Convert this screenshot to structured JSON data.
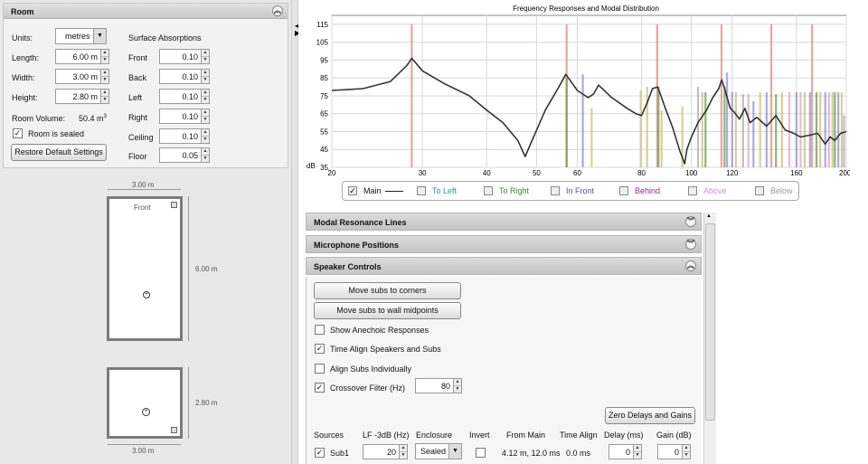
{
  "room": {
    "title": "Room",
    "units_label": "Units:",
    "units_value": "metres",
    "length_label": "Length:",
    "length_value": "6.00 m",
    "width_label": "Width:",
    "width_value": "3.00 m",
    "height_label": "Height:",
    "height_value": "2.80 m",
    "volume_label": "Room Volume:",
    "volume_value": "50.4 m",
    "volume_sup": "3",
    "sealed_label": "Room is sealed",
    "sealed_checked": true,
    "restore_button": "Restore Default Settings",
    "absorptions_title": "Surface Absorptions",
    "absorptions": [
      {
        "label": "Front",
        "value": "0.10"
      },
      {
        "label": "Back",
        "value": "0.10"
      },
      {
        "label": "Left",
        "value": "0.10"
      },
      {
        "label": "Right",
        "value": "0.10"
      },
      {
        "label": "Ceiling",
        "value": "0.10"
      },
      {
        "label": "Floor",
        "value": "0.05"
      }
    ]
  },
  "plan": {
    "top_width": "3.00 m",
    "side_length": "6.00 m",
    "front_label": "Front",
    "side_height": "2.80 m",
    "bottom_width": "3.00 m"
  },
  "chart_data": {
    "type": "line",
    "title": "Frequency Responses and Modal Distribution",
    "yunit": "dB",
    "y_ticks": [
      "35",
      "45",
      "55",
      "65",
      "75",
      "85",
      "95",
      "105",
      "115"
    ],
    "x_ticks": [
      "20",
      "30",
      "40",
      "50",
      "60",
      "80",
      "100",
      "120",
      "160",
      "200 Hz"
    ],
    "x_tick_values": [
      20,
      30,
      40,
      50,
      60,
      80,
      100,
      120,
      160,
      200
    ],
    "xscale": "log",
    "xlim": [
      20,
      200
    ],
    "ylim": [
      35,
      120
    ],
    "grid": true,
    "series": [
      {
        "name": "Main",
        "x": [
          20,
          23,
          26,
          28,
          28.6,
          30,
          33,
          37,
          40,
          43,
          46,
          47.5,
          49,
          52,
          55,
          57,
          58,
          60,
          61.5,
          63,
          64.5,
          66,
          70,
          75,
          78,
          80,
          82,
          84,
          86,
          87,
          89,
          92,
          95,
          97,
          98,
          100,
          103,
          107,
          110,
          113,
          114.5,
          116,
          119,
          121,
          124,
          127,
          130,
          134,
          140,
          146,
          152,
          158,
          163,
          170,
          176,
          182,
          186,
          190,
          195,
          200
        ],
        "y": [
          78,
          79,
          83,
          92,
          96,
          89,
          82,
          75,
          67,
          60,
          50,
          41,
          50,
          67,
          79,
          87,
          84,
          78,
          76,
          74,
          76,
          81,
          74,
          68,
          65,
          64,
          71,
          79,
          80,
          76,
          68,
          57,
          44,
          37,
          45,
          52,
          60,
          67,
          74,
          79,
          84,
          79,
          68,
          66,
          62,
          68,
          60,
          63,
          58,
          64,
          56,
          54,
          52,
          53,
          54,
          48,
          52,
          50,
          54,
          55
        ]
      }
    ],
    "modes": {
      "colors": {
        "red": "#d98a8a",
        "green": "#6e9a4a",
        "blue": "#8d91d2",
        "olive": "#c9c078",
        "pink": "#e2a0cc",
        "gray": "#aaaaaa"
      },
      "lines": [
        {
          "f": 28.6,
          "h": 115,
          "c": "red"
        },
        {
          "f": 57.2,
          "h": 115,
          "c": "red"
        },
        {
          "f": 57.2,
          "h": 85,
          "c": "green"
        },
        {
          "f": 61.5,
          "h": 87,
          "c": "blue"
        },
        {
          "f": 64,
          "h": 68,
          "c": "olive"
        },
        {
          "f": 79.7,
          "h": 78,
          "c": "olive"
        },
        {
          "f": 82,
          "h": 80,
          "c": "olive"
        },
        {
          "f": 85.8,
          "h": 115,
          "c": "red"
        },
        {
          "f": 86.3,
          "h": 80,
          "c": "green"
        },
        {
          "f": 87.5,
          "h": 67,
          "c": "olive"
        },
        {
          "f": 96,
          "h": 69,
          "c": "olive"
        },
        {
          "f": 103,
          "h": 80,
          "c": "gray"
        },
        {
          "f": 105,
          "h": 77,
          "c": "olive"
        },
        {
          "f": 106.5,
          "h": 77,
          "c": "green"
        },
        {
          "f": 114.4,
          "h": 115,
          "c": "red"
        },
        {
          "f": 116,
          "h": 80,
          "c": "green"
        },
        {
          "f": 117.3,
          "h": 88,
          "c": "blue"
        },
        {
          "f": 120,
          "h": 77,
          "c": "blue"
        },
        {
          "f": 122,
          "h": 77,
          "c": "olive"
        },
        {
          "f": 126,
          "h": 76,
          "c": "gray"
        },
        {
          "f": 129,
          "h": 76,
          "c": "pink"
        },
        {
          "f": 132,
          "h": 72,
          "c": "blue"
        },
        {
          "f": 136,
          "h": 77,
          "c": "olive"
        },
        {
          "f": 140,
          "h": 77,
          "c": "blue"
        },
        {
          "f": 143,
          "h": 115,
          "c": "red"
        },
        {
          "f": 146,
          "h": 76,
          "c": "green"
        },
        {
          "f": 150,
          "h": 77,
          "c": "olive"
        },
        {
          "f": 155,
          "h": 77,
          "c": "pink"
        },
        {
          "f": 160,
          "h": 77,
          "c": "blue"
        },
        {
          "f": 163,
          "h": 77,
          "c": "pink"
        },
        {
          "f": 166,
          "h": 77,
          "c": "olive"
        },
        {
          "f": 170,
          "h": 77,
          "c": "blue"
        },
        {
          "f": 171.6,
          "h": 115,
          "c": "red"
        },
        {
          "f": 175,
          "h": 77,
          "c": "green"
        },
        {
          "f": 178,
          "h": 77,
          "c": "olive"
        },
        {
          "f": 182,
          "h": 77,
          "c": "blue"
        },
        {
          "f": 185,
          "h": 77,
          "c": "pink"
        },
        {
          "f": 188,
          "h": 77,
          "c": "olive"
        },
        {
          "f": 190,
          "h": 77,
          "c": "green"
        },
        {
          "f": 193,
          "h": 77,
          "c": "blue"
        },
        {
          "f": 196,
          "h": 77,
          "c": "olive"
        },
        {
          "f": 198,
          "h": 64,
          "c": "gray"
        }
      ]
    }
  },
  "legend": [
    {
      "label": "Main",
      "color": "#222222",
      "checked": true
    },
    {
      "label": "To Left",
      "color": "#3a8f99",
      "checked": false
    },
    {
      "label": "To Right",
      "color": "#3d8a2f",
      "checked": false
    },
    {
      "label": "In Front",
      "color": "#5a4aa8",
      "checked": false
    },
    {
      "label": "Behind",
      "color": "#8e2a8a",
      "checked": false
    },
    {
      "label": "Above",
      "color": "#d78ad6",
      "checked": false
    },
    {
      "label": "Below",
      "color": "#999999",
      "checked": false
    }
  ],
  "sections": {
    "modal": "Modal Resonance Lines",
    "mic": "Microphone Positions",
    "speaker": "Speaker Controls"
  },
  "speaker": {
    "move_corners": "Move subs to corners",
    "move_midpoints": "Move subs to wall midpoints",
    "show_anechoic": "Show Anechoic Responses",
    "show_anechoic_checked": false,
    "time_align": "Time Align Speakers and Subs",
    "time_align_checked": true,
    "align_subs": "Align Subs Individually",
    "align_subs_checked": false,
    "crossover": "Crossover Filter (Hz)",
    "crossover_checked": true,
    "crossover_value": "80",
    "zero_delays": "Zero Delays and Gains",
    "columns": [
      "Sources",
      "LF -3dB (Hz)",
      "Enclosure",
      "Invert",
      "From Main",
      "Time Align",
      "Delay (ms)",
      "Gain (dB)"
    ],
    "row": {
      "name": "Sub1",
      "checked": true,
      "lf": "20",
      "enclosure": "Sealed",
      "invert": false,
      "from_main": "4.12 m, 12.0 ms",
      "time_align": "0.0 ms",
      "delay": "0",
      "gain": "0"
    }
  }
}
